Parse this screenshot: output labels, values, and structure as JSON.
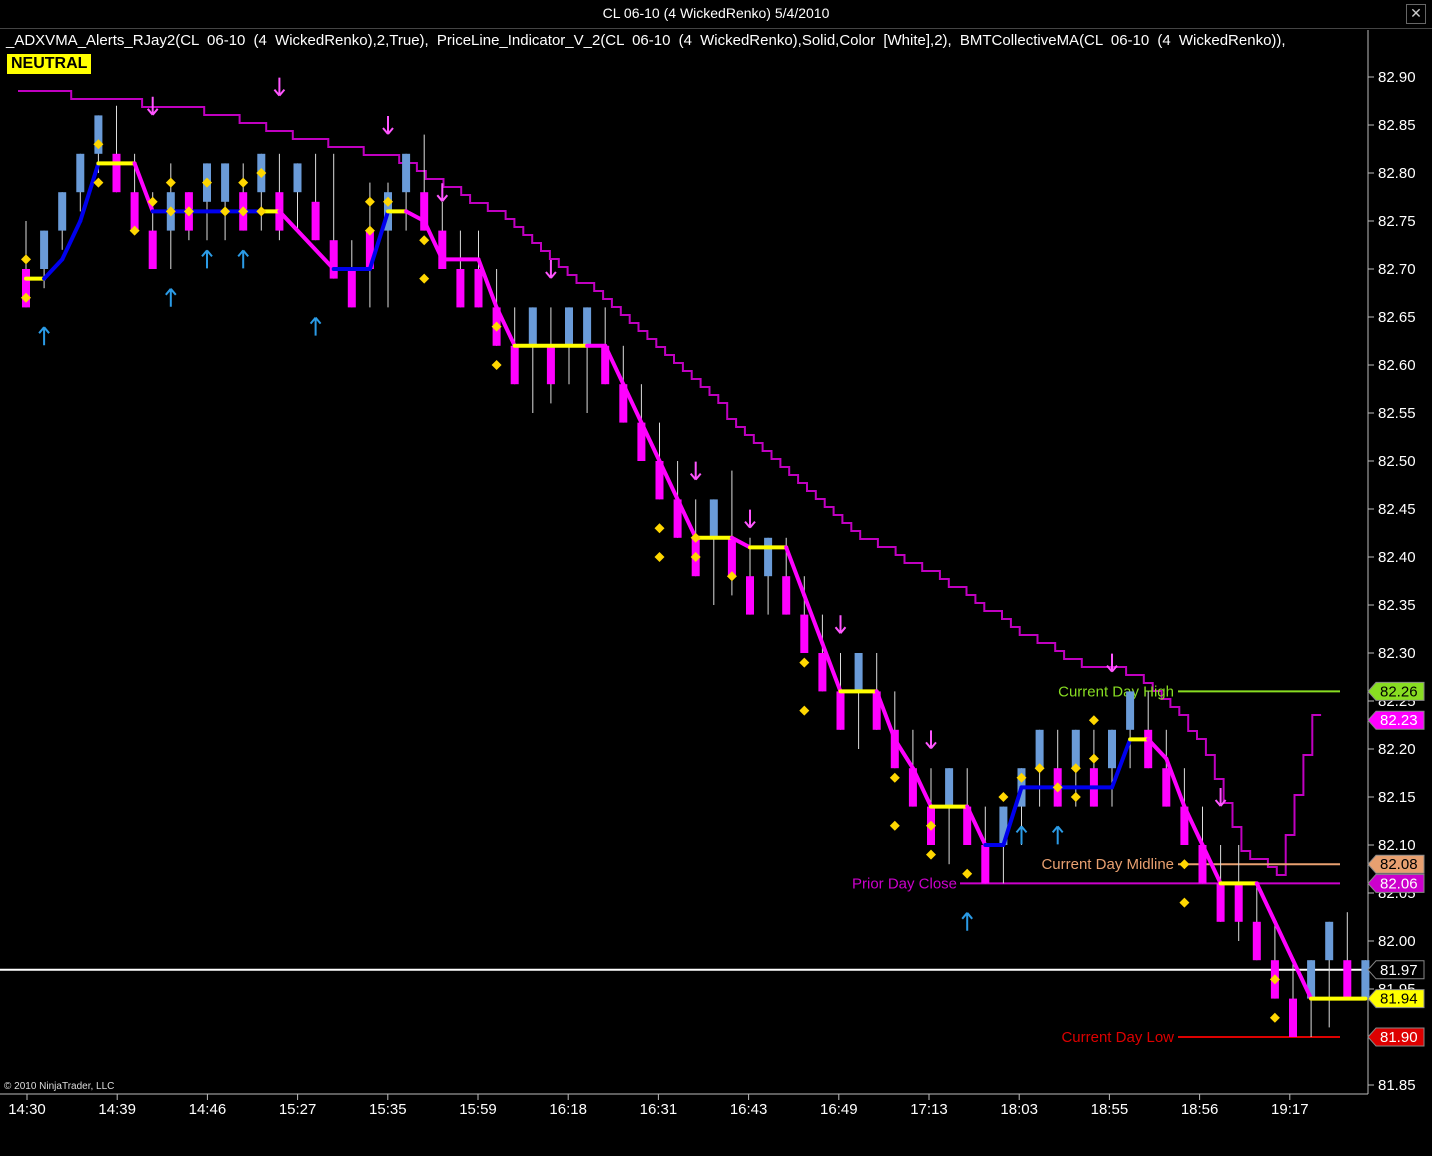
{
  "window": {
    "title": "CL 06-10 (4 WickedRenko)  5/4/2010",
    "close_glyph": "✕"
  },
  "indicators_label": "_ADXVMA_Alerts_RJay2(CL 06-10 (4 WickedRenko),2,True), PriceLine_Indicator_V_2(CL 06-10 (4 WickedRenko),Solid,Color [White],2), BMTCollectiveMA(CL 06-10 (4 WickedRenko)),",
  "status_badge": "NEUTRAL",
  "copyright": "© 2010 NinjaTrader, LLC",
  "colors": {
    "up_bar": "#6a9bd8",
    "down_bar": "#ff00ff",
    "adx_down": "#ff00ff",
    "adx_up": "#0000ee",
    "adx_flat": "#ffff00",
    "ma": "#c000c0",
    "dot": "#ffd700",
    "arrow_up": "#2b9be6",
    "arrow_down": "#ff55ff"
  },
  "chart_data": {
    "type": "candlestick",
    "instrument": "CL 06-10",
    "bar_type": "4 WickedRenko",
    "date": "5/4/2010",
    "ylim": [
      81.83,
      82.93
    ],
    "yticks": [
      "82.90",
      "82.85",
      "82.80",
      "82.75",
      "82.70",
      "82.65",
      "82.60",
      "82.55",
      "82.50",
      "82.45",
      "82.40",
      "82.35",
      "82.30",
      "82.25",
      "82.20",
      "82.15",
      "82.10",
      "82.05",
      "82.00",
      "81.95",
      "81.90",
      "81.85"
    ],
    "xticks": [
      "14:30",
      "14:39",
      "14:46",
      "15:27",
      "15:35",
      "15:59",
      "16:18",
      "16:31",
      "16:43",
      "16:49",
      "17:13",
      "18:03",
      "18:55",
      "18:56",
      "19:17"
    ],
    "bars": [
      {
        "d": "down",
        "o": 82.7,
        "c": 82.66,
        "h": 82.75,
        "l": 82.66
      },
      {
        "d": "up",
        "o": 82.7,
        "c": 82.74,
        "h": 82.74,
        "l": 82.68
      },
      {
        "d": "up",
        "o": 82.74,
        "c": 82.78,
        "h": 82.78,
        "l": 82.72
      },
      {
        "d": "up",
        "o": 82.78,
        "c": 82.82,
        "h": 82.82,
        "l": 82.76
      },
      {
        "d": "up",
        "o": 82.82,
        "c": 82.86,
        "h": 82.86,
        "l": 82.8
      },
      {
        "d": "down",
        "o": 82.82,
        "c": 82.78,
        "h": 82.87,
        "l": 82.78
      },
      {
        "d": "down",
        "o": 82.78,
        "c": 82.74,
        "h": 82.82,
        "l": 82.74
      },
      {
        "d": "down",
        "o": 82.74,
        "c": 82.7,
        "h": 82.78,
        "l": 82.7
      },
      {
        "d": "up",
        "o": 82.74,
        "c": 82.78,
        "h": 82.81,
        "l": 82.7
      },
      {
        "d": "down",
        "o": 82.78,
        "c": 82.74,
        "h": 82.78,
        "l": 82.73
      },
      {
        "d": "up",
        "o": 82.77,
        "c": 82.81,
        "h": 82.81,
        "l": 82.73
      },
      {
        "d": "up",
        "o": 82.77,
        "c": 82.81,
        "h": 82.81,
        "l": 82.73
      },
      {
        "d": "down",
        "o": 82.78,
        "c": 82.74,
        "h": 82.81,
        "l": 82.74
      },
      {
        "d": "up",
        "o": 82.78,
        "c": 82.82,
        "h": 82.82,
        "l": 82.74
      },
      {
        "d": "down",
        "o": 82.78,
        "c": 82.74,
        "h": 82.82,
        "l": 82.73
      },
      {
        "d": "up",
        "o": 82.78,
        "c": 82.81,
        "h": 82.81,
        "l": 82.74
      },
      {
        "d": "down",
        "o": 82.77,
        "c": 82.73,
        "h": 82.82,
        "l": 82.73
      },
      {
        "d": "down",
        "o": 82.73,
        "c": 82.69,
        "h": 82.82,
        "l": 82.69
      },
      {
        "d": "down",
        "o": 82.7,
        "c": 82.66,
        "h": 82.73,
        "l": 82.66
      },
      {
        "d": "down",
        "o": 82.74,
        "c": 82.7,
        "h": 82.79,
        "l": 82.66
      },
      {
        "d": "up",
        "o": 82.74,
        "c": 82.78,
        "h": 82.79,
        "l": 82.66
      },
      {
        "d": "up",
        "o": 82.78,
        "c": 82.82,
        "h": 82.82,
        "l": 82.74
      },
      {
        "d": "down",
        "o": 82.78,
        "c": 82.74,
        "h": 82.84,
        "l": 82.74
      },
      {
        "d": "down",
        "o": 82.74,
        "c": 82.7,
        "h": 82.77,
        "l": 82.7
      },
      {
        "d": "down",
        "o": 82.7,
        "c": 82.66,
        "h": 82.74,
        "l": 82.66
      },
      {
        "d": "down",
        "o": 82.7,
        "c": 82.66,
        "h": 82.74,
        "l": 82.66
      },
      {
        "d": "down",
        "o": 82.66,
        "c": 82.62,
        "h": 82.7,
        "l": 82.62
      },
      {
        "d": "down",
        "o": 82.62,
        "c": 82.58,
        "h": 82.66,
        "l": 82.58
      },
      {
        "d": "up",
        "o": 82.62,
        "c": 82.66,
        "h": 82.66,
        "l": 82.55
      },
      {
        "d": "down",
        "o": 82.62,
        "c": 82.58,
        "h": 82.66,
        "l": 82.56
      },
      {
        "d": "up",
        "o": 82.62,
        "c": 82.66,
        "h": 82.66,
        "l": 82.58
      },
      {
        "d": "up",
        "o": 82.62,
        "c": 82.66,
        "h": 82.66,
        "l": 82.55
      },
      {
        "d": "down",
        "o": 82.62,
        "c": 82.58,
        "h": 82.66,
        "l": 82.58
      },
      {
        "d": "down",
        "o": 82.58,
        "c": 82.54,
        "h": 82.62,
        "l": 82.54
      },
      {
        "d": "down",
        "o": 82.54,
        "c": 82.5,
        "h": 82.58,
        "l": 82.5
      },
      {
        "d": "down",
        "o": 82.5,
        "c": 82.46,
        "h": 82.54,
        "l": 82.46
      },
      {
        "d": "down",
        "o": 82.46,
        "c": 82.42,
        "h": 82.5,
        "l": 82.42
      },
      {
        "d": "down",
        "o": 82.42,
        "c": 82.38,
        "h": 82.46,
        "l": 82.38
      },
      {
        "d": "up",
        "o": 82.42,
        "c": 82.46,
        "h": 82.46,
        "l": 82.35
      },
      {
        "d": "down",
        "o": 82.42,
        "c": 82.38,
        "h": 82.49,
        "l": 82.36
      },
      {
        "d": "down",
        "o": 82.38,
        "c": 82.34,
        "h": 82.42,
        "l": 82.34
      },
      {
        "d": "up",
        "o": 82.38,
        "c": 82.42,
        "h": 82.42,
        "l": 82.34
      },
      {
        "d": "down",
        "o": 82.38,
        "c": 82.34,
        "h": 82.42,
        "l": 82.34
      },
      {
        "d": "down",
        "o": 82.34,
        "c": 82.3,
        "h": 82.38,
        "l": 82.3
      },
      {
        "d": "down",
        "o": 82.3,
        "c": 82.26,
        "h": 82.34,
        "l": 82.26
      },
      {
        "d": "down",
        "o": 82.26,
        "c": 82.22,
        "h": 82.3,
        "l": 82.22
      },
      {
        "d": "up",
        "o": 82.26,
        "c": 82.3,
        "h": 82.3,
        "l": 82.2
      },
      {
        "d": "down",
        "o": 82.26,
        "c": 82.22,
        "h": 82.3,
        "l": 82.22
      },
      {
        "d": "down",
        "o": 82.22,
        "c": 82.18,
        "h": 82.26,
        "l": 82.18
      },
      {
        "d": "down",
        "o": 82.18,
        "c": 82.14,
        "h": 82.22,
        "l": 82.14
      },
      {
        "d": "down",
        "o": 82.14,
        "c": 82.1,
        "h": 82.18,
        "l": 82.1
      },
      {
        "d": "up",
        "o": 82.14,
        "c": 82.18,
        "h": 82.18,
        "l": 82.08
      },
      {
        "d": "down",
        "o": 82.14,
        "c": 82.1,
        "h": 82.18,
        "l": 82.1
      },
      {
        "d": "down",
        "o": 82.1,
        "c": 82.06,
        "h": 82.14,
        "l": 82.06
      },
      {
        "d": "up",
        "o": 82.1,
        "c": 82.14,
        "h": 82.14,
        "l": 82.06
      },
      {
        "d": "up",
        "o": 82.14,
        "c": 82.18,
        "h": 82.18,
        "l": 82.1
      },
      {
        "d": "up",
        "o": 82.18,
        "c": 82.22,
        "h": 82.22,
        "l": 82.14
      },
      {
        "d": "down",
        "o": 82.18,
        "c": 82.14,
        "h": 82.22,
        "l": 82.14
      },
      {
        "d": "up",
        "o": 82.18,
        "c": 82.22,
        "h": 82.22,
        "l": 82.14
      },
      {
        "d": "down",
        "o": 82.18,
        "c": 82.14,
        "h": 82.22,
        "l": 82.14
      },
      {
        "d": "up",
        "o": 82.18,
        "c": 82.22,
        "h": 82.22,
        "l": 82.14
      },
      {
        "d": "up",
        "o": 82.22,
        "c": 82.26,
        "h": 82.26,
        "l": 82.18
      },
      {
        "d": "down",
        "o": 82.22,
        "c": 82.18,
        "h": 82.26,
        "l": 82.18
      },
      {
        "d": "down",
        "o": 82.18,
        "c": 82.14,
        "h": 82.22,
        "l": 82.14
      },
      {
        "d": "down",
        "o": 82.14,
        "c": 82.1,
        "h": 82.18,
        "l": 82.1
      },
      {
        "d": "down",
        "o": 82.1,
        "c": 82.06,
        "h": 82.14,
        "l": 82.06
      },
      {
        "d": "down",
        "o": 82.06,
        "c": 82.02,
        "h": 82.1,
        "l": 82.02
      },
      {
        "d": "down",
        "o": 82.06,
        "c": 82.02,
        "h": 82.1,
        "l": 82.0
      },
      {
        "d": "down",
        "o": 82.02,
        "c": 81.98,
        "h": 82.06,
        "l": 81.98
      },
      {
        "d": "down",
        "o": 81.98,
        "c": 81.94,
        "h": 82.02,
        "l": 81.94
      },
      {
        "d": "down",
        "o": 81.94,
        "c": 81.9,
        "h": 81.98,
        "l": 81.9
      },
      {
        "d": "up",
        "o": 81.94,
        "c": 81.98,
        "h": 81.98,
        "l": 81.9
      },
      {
        "d": "up",
        "o": 81.98,
        "c": 82.02,
        "h": 82.02,
        "l": 81.91
      },
      {
        "d": "down",
        "o": 81.98,
        "c": 81.94,
        "h": 82.03,
        "l": 81.94
      },
      {
        "d": "up",
        "o": 81.94,
        "c": 81.98,
        "h": 81.98,
        "l": 81.94
      }
    ],
    "adx_vma": [
      [
        0,
        82.69,
        "flat"
      ],
      [
        1,
        82.69,
        "up"
      ],
      [
        2,
        82.71,
        "up"
      ],
      [
        3,
        82.75,
        "up"
      ],
      [
        4,
        82.81,
        "flat"
      ],
      [
        6,
        82.81,
        "down"
      ],
      [
        7,
        82.76,
        "up"
      ],
      [
        8,
        82.76,
        "up"
      ],
      [
        10,
        82.76,
        "up"
      ],
      [
        13,
        82.76,
        "flat"
      ],
      [
        14,
        82.76,
        "down"
      ],
      [
        17,
        82.7,
        "up"
      ],
      [
        19,
        82.7,
        "up"
      ],
      [
        20,
        82.76,
        "flat"
      ],
      [
        21,
        82.76,
        "down"
      ],
      [
        22,
        82.75,
        "down"
      ],
      [
        23,
        82.71,
        "down"
      ],
      [
        25,
        82.71,
        "down"
      ],
      [
        26,
        82.66,
        "down"
      ],
      [
        27,
        82.62,
        "flat"
      ],
      [
        31,
        82.62,
        "down"
      ],
      [
        32,
        82.62,
        "down"
      ],
      [
        33,
        82.58,
        "down"
      ],
      [
        34,
        82.54,
        "down"
      ],
      [
        35,
        82.5,
        "down"
      ],
      [
        36,
        82.46,
        "down"
      ],
      [
        37,
        82.42,
        "flat"
      ],
      [
        39,
        82.42,
        "down"
      ],
      [
        40,
        82.41,
        "flat"
      ],
      [
        42,
        82.41,
        "down"
      ],
      [
        43,
        82.36,
        "down"
      ],
      [
        44,
        82.31,
        "down"
      ],
      [
        45,
        82.26,
        "flat"
      ],
      [
        47,
        82.26,
        "down"
      ],
      [
        48,
        82.21,
        "down"
      ],
      [
        49,
        82.18,
        "down"
      ],
      [
        50,
        82.14,
        "flat"
      ],
      [
        52,
        82.14,
        "down"
      ],
      [
        53,
        82.1,
        "up"
      ],
      [
        54,
        82.1,
        "up"
      ],
      [
        55,
        82.16,
        "up"
      ],
      [
        58,
        82.16,
        "up"
      ],
      [
        60,
        82.16,
        "up"
      ],
      [
        61,
        82.21,
        "flat"
      ],
      [
        62,
        82.21,
        "down"
      ],
      [
        63,
        82.19,
        "down"
      ],
      [
        64,
        82.14,
        "down"
      ],
      [
        65,
        82.1,
        "down"
      ],
      [
        66,
        82.06,
        "flat"
      ],
      [
        68,
        82.06,
        "down"
      ],
      [
        69,
        82.02,
        "down"
      ],
      [
        70,
        81.98,
        "down"
      ],
      [
        71,
        81.94,
        "flat"
      ],
      [
        74,
        81.94,
        "down"
      ]
    ],
    "dots": [
      [
        0,
        82.71
      ],
      [
        0,
        82.67
      ],
      [
        4,
        82.83
      ],
      [
        4,
        82.79
      ],
      [
        6,
        82.74
      ],
      [
        7,
        82.77
      ],
      [
        8,
        82.79
      ],
      [
        8,
        82.76
      ],
      [
        9,
        82.76
      ],
      [
        10,
        82.79
      ],
      [
        11,
        82.76
      ],
      [
        12,
        82.79
      ],
      [
        12,
        82.76
      ],
      [
        13,
        82.8
      ],
      [
        13,
        82.76
      ],
      [
        19,
        82.77
      ],
      [
        19,
        82.74
      ],
      [
        20,
        82.77
      ],
      [
        22,
        82.73
      ],
      [
        22,
        82.69
      ],
      [
        26,
        82.64
      ],
      [
        26,
        82.6
      ],
      [
        35,
        82.43
      ],
      [
        35,
        82.4
      ],
      [
        37,
        82.42
      ],
      [
        37,
        82.4
      ],
      [
        39,
        82.38
      ],
      [
        43,
        82.29
      ],
      [
        43,
        82.24
      ],
      [
        48,
        82.17
      ],
      [
        48,
        82.12
      ],
      [
        50,
        82.12
      ],
      [
        50,
        82.09
      ],
      [
        52,
        82.07
      ],
      [
        54,
        82.15
      ],
      [
        55,
        82.17
      ],
      [
        56,
        82.18
      ],
      [
        57,
        82.16
      ],
      [
        58,
        82.18
      ],
      [
        58,
        82.15
      ],
      [
        59,
        82.23
      ],
      [
        59,
        82.19
      ],
      [
        64,
        82.08
      ],
      [
        64,
        82.04
      ],
      [
        69,
        81.96
      ],
      [
        69,
        81.92
      ]
    ],
    "arrows": [
      {
        "i": 1,
        "dir": "up",
        "p": 82.63
      },
      {
        "i": 7,
        "dir": "down",
        "p": 82.87
      },
      {
        "i": 8,
        "dir": "up",
        "p": 82.67
      },
      {
        "i": 10,
        "dir": "up",
        "p": 82.71
      },
      {
        "i": 12,
        "dir": "up",
        "p": 82.71
      },
      {
        "i": 14,
        "dir": "down",
        "p": 82.89
      },
      {
        "i": 16,
        "dir": "up",
        "p": 82.64
      },
      {
        "i": 20,
        "dir": "down",
        "p": 82.85
      },
      {
        "i": 23,
        "dir": "down",
        "p": 82.78
      },
      {
        "i": 29,
        "dir": "down",
        "p": 82.7
      },
      {
        "i": 37,
        "dir": "down",
        "p": 82.49
      },
      {
        "i": 40,
        "dir": "down",
        "p": 82.44
      },
      {
        "i": 45,
        "dir": "down",
        "p": 82.33
      },
      {
        "i": 50,
        "dir": "down",
        "p": 82.21
      },
      {
        "i": 52,
        "dir": "up",
        "p": 82.02
      },
      {
        "i": 55,
        "dir": "up",
        "p": 82.11
      },
      {
        "i": 57,
        "dir": "up",
        "p": 82.11
      },
      {
        "i": 60,
        "dir": "down",
        "p": 82.29
      },
      {
        "i": 66,
        "dir": "down",
        "p": 82.15
      }
    ],
    "ma_line": [
      [
        0,
        82.89
      ],
      [
        5,
        82.88
      ],
      [
        10,
        82.87
      ],
      [
        14,
        82.85
      ],
      [
        18,
        82.83
      ],
      [
        21,
        82.82
      ],
      [
        24,
        82.79
      ],
      [
        28,
        82.75
      ],
      [
        31,
        82.7
      ],
      [
        35,
        82.64
      ],
      [
        38,
        82.59
      ],
      [
        41,
        82.53
      ],
      [
        44,
        82.48
      ],
      [
        47,
        82.43
      ],
      [
        50,
        82.4
      ],
      [
        53,
        82.37
      ],
      [
        56,
        82.33
      ],
      [
        58,
        82.31
      ],
      [
        60,
        82.29
      ],
      [
        62,
        82.29
      ],
      [
        65,
        82.25
      ],
      [
        67,
        82.2
      ],
      [
        69,
        82.1
      ],
      [
        71,
        82.07
      ],
      [
        73,
        82.24
      ],
      [
        74,
        82.23
      ]
    ],
    "levels": [
      {
        "label": "Current Day High",
        "value": 82.26,
        "tag": "82.26",
        "color": "#88dd22",
        "tag_bg": "#88dd22",
        "tag_fg": "#000000"
      },
      {
        "label": "Current Day Midline",
        "value": 82.08,
        "tag": "82.08",
        "color": "#e8a070",
        "tag_bg": "#e8a070",
        "tag_fg": "#000000"
      },
      {
        "label": "Prior Day Close",
        "value": 82.06,
        "tag": "82.06",
        "color": "#cc00cc",
        "tag_bg": "#cc00cc",
        "tag_fg": "#ffffff"
      },
      {
        "label": "Current Day Low",
        "value": 81.9,
        "tag": "81.90",
        "color": "#dd0000",
        "tag_bg": "#dd0000",
        "tag_fg": "#ffffff"
      }
    ],
    "price_line": {
      "value": 81.97,
      "tag": "81.97"
    },
    "last_price": {
      "value": 81.94,
      "tag": "81.94"
    },
    "ma_tag": {
      "value": 82.23,
      "tag": "82.23"
    }
  }
}
